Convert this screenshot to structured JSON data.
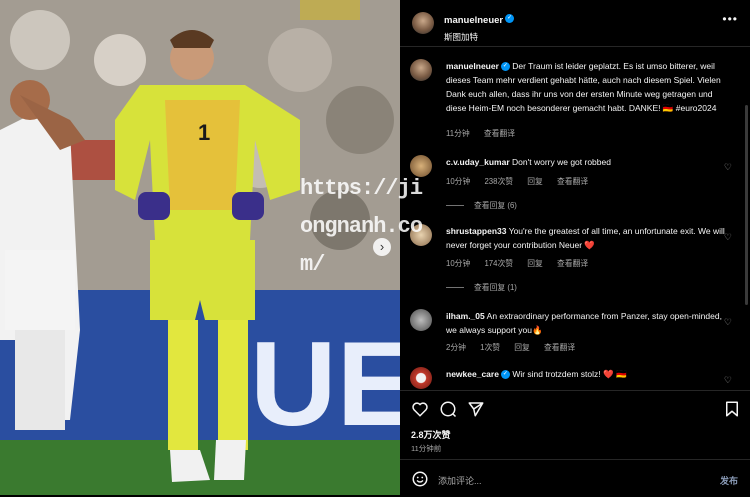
{
  "photo": {
    "watermark": "https://jiongnanh.com/",
    "watermark_lines": [
      "https://ji",
      "ongnanh.co",
      "m/"
    ],
    "next_icon": "chevron-right-icon"
  },
  "post": {
    "author": "manuelneuer",
    "location": "斯图加特",
    "caption_user": "manuelneuer",
    "caption": "Der Traum ist leider geplatzt. Es ist umso bitterer, weil dieses Team mehr verdient gehabt hätte, auch nach diesem Spiel. Vielen Dank euch allen, dass ihr uns von der ersten Minute weg getragen und diese Heim-EM noch besonderer gemacht habt. DANKE! 🇩🇪 #euro2024",
    "caption_time": "11分钟",
    "see_translation": "查看翻译"
  },
  "comments": [
    {
      "user": "c.v.uday_kumar",
      "text": "Don't worry we got robbed",
      "time": "10分钟",
      "likes": "238次赞",
      "reply": "回复",
      "translate": "查看翻译",
      "view_replies": "查看回复 (6)"
    },
    {
      "user": "shrustappen33",
      "text": "You're the greatest of all time, an unfortunate exit. We will never forget your contribution Neuer ❤️",
      "time": "10分钟",
      "likes": "174次赞",
      "reply": "回复",
      "translate": "查看翻译",
      "view_replies": "查看回复 (1)"
    },
    {
      "user": "ilham._05",
      "text": "An extraordinary performance from Panzer, stay open-minded, we always support you🔥",
      "time": "2分钟",
      "likes": "1次赞",
      "reply": "回复",
      "translate": "查看翻译"
    },
    {
      "user": "newkee_care",
      "text": "Wir sind trotzdem stolz! ❤️ 🇩🇪"
    }
  ],
  "actions": {
    "likes": "2.8万次赞",
    "time": "11分钟前",
    "add_comment_placeholder": "添加评论...",
    "post_label": "发布"
  },
  "colors": {
    "verified": "#0095f6",
    "background": "#000000",
    "muted": "#a8a8a8"
  }
}
